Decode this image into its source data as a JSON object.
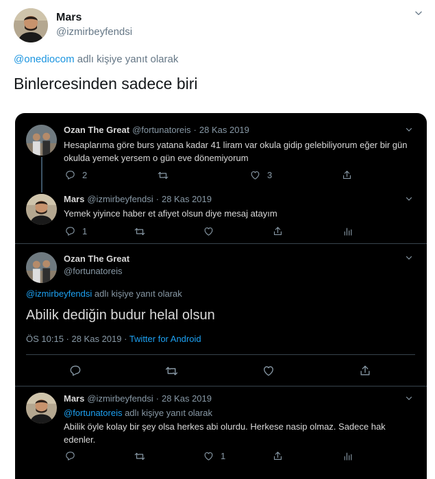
{
  "outer": {
    "name": "Mars",
    "handle": "@izmirbeyfendsi",
    "reply_mention": "@onediocom",
    "reply_suffix": " adlı kişiye yanıt olarak",
    "text": "Binlercesinden sadece biri"
  },
  "thread": {
    "t1": {
      "name": "Ozan The Great",
      "handle": "@fortunatoreis",
      "dot": "·",
      "date": "28 Kas 2019",
      "text": "Hesaplarıma göre burs yatana kadar 41 liram var okula gidip gelebiliyorum eğer bir gün okulda yemek yersem o gün eve dönemiyorum",
      "replies": "2",
      "likes": "3"
    },
    "t2": {
      "name": "Mars",
      "handle": "@izmirbeyfendsi",
      "dot": "·",
      "date": "28 Kas 2019",
      "text": "Yemek yiyince haber et afiyet olsun diye mesaj atayım",
      "replies": "1"
    },
    "t3": {
      "name": "Ozan The Great",
      "handle": "@fortunatoreis",
      "reply_mention": "@izmirbeyfendsi",
      "reply_suffix": " adlı kişiye yanıt olarak",
      "text": "Abilik dediğin budur helal olsun",
      "timestamp": "ÖS 10:15 · 28 Kas 2019 · ",
      "source": "Twitter for Android"
    },
    "t4": {
      "name": "Mars",
      "handle": "@izmirbeyfendsi",
      "dot": "·",
      "date": "28 Kas 2019",
      "reply_mention": "@fortunatoreis",
      "reply_suffix": " adlı kişiye yanıt olarak",
      "text": "Abilik öyle kolay bir şey olsa herkes abi olurdu. Herkese nasip olmaz. Sadece hak edenler.",
      "likes": "1"
    }
  },
  "colors": {
    "accent": "#1da1f2",
    "embed_bg": "#000000",
    "muted": "#8899a6"
  }
}
